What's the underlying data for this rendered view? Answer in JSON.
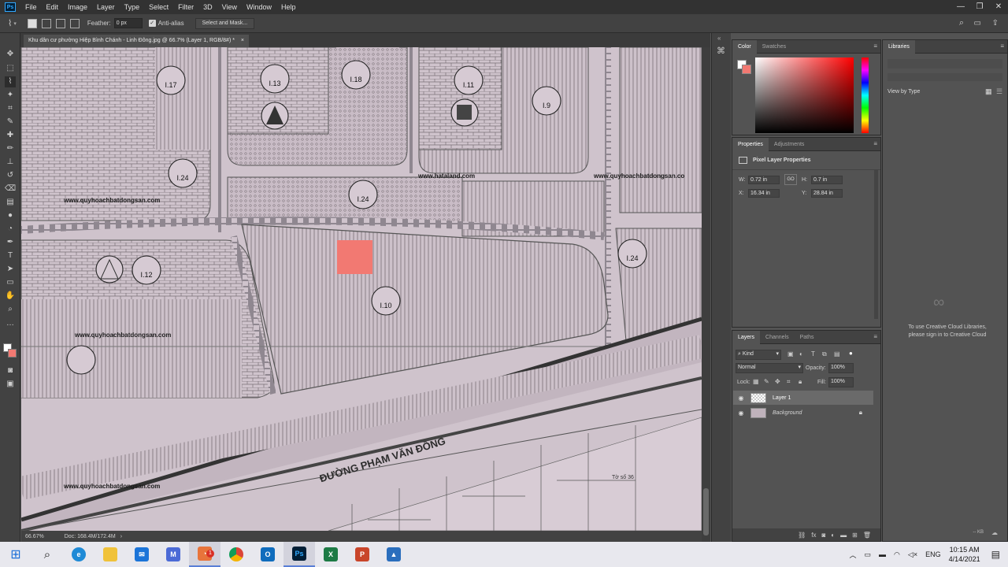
{
  "menubar": {
    "logo": "Ps",
    "items": [
      "File",
      "Edit",
      "Image",
      "Layer",
      "Type",
      "Select",
      "Filter",
      "3D",
      "View",
      "Window",
      "Help"
    ],
    "window_controls": [
      "—",
      "❐",
      "✕"
    ]
  },
  "options_bar": {
    "feather_label": "Feather:",
    "feather_value": "0 px",
    "anti_alias_label": "Anti-alias",
    "select_mask_button": "Select and Mask..."
  },
  "document": {
    "tab_title": "Khu dân cư phường Hiệp Bình Chánh - Linh Đông.jpg @ 66.7% (Layer 1, RGB/8#) *",
    "tab_close": "×",
    "zoom": "66.67%",
    "doc_size": "Doc: 168.4M/172.4M",
    "watermarks": [
      "www.quyhoachbatdongsan.com",
      "www.hataland.com",
      "www.quyhoachbatdongsan.co",
      "www.quyhoachbatdongsan.com",
      "www.quyhoachbatdongsan.com"
    ],
    "map_labels": [
      "I.17",
      "I.13",
      "I.18",
      "I.11",
      "I.9",
      "I.24",
      "I.24",
      "I.24",
      "I.12",
      "I.10",
      "ĐƯỜNG PHẠM VĂN ĐỒNG",
      "Tờ số 36"
    ]
  },
  "color_panel": {
    "tabs": [
      "Color",
      "Swatches"
    ],
    "foreground": "#ffffff",
    "background": "#f27972"
  },
  "properties_panel": {
    "tabs": [
      "Properties",
      "Adjustments"
    ],
    "title": "Pixel Layer Properties",
    "w_label": "W:",
    "w_value": "0.72 in",
    "h_label": "H:",
    "h_value": "0.7 in",
    "x_label": "X:",
    "x_value": "16.34 in",
    "y_label": "Y:",
    "y_value": "28.84 in",
    "link": "GO"
  },
  "layers_panel": {
    "tabs": [
      "Layers",
      "Channels",
      "Paths"
    ],
    "kind_label": "Kind",
    "blend_mode": "Normal",
    "opacity_label": "Opacity:",
    "opacity_value": "100%",
    "lock_label": "Lock:",
    "fill_label": "Fill:",
    "fill_value": "100%",
    "layers": [
      {
        "name": "Layer 1",
        "visible": true
      },
      {
        "name": "Background",
        "visible": true,
        "locked": true
      }
    ]
  },
  "libraries_panel": {
    "title": "Libraries",
    "view_by": "View by Type",
    "message": "To use Creative Cloud Libraries, please sign in to Creative Cloud",
    "footer": "-- KB"
  },
  "taskbar": {
    "language": "ENG",
    "time": "10:15 AM",
    "date": "4/14/2021",
    "notification_badge": "1"
  },
  "colors": {
    "accent_red": "#f27972",
    "ps_blue": "#31a8ff"
  }
}
